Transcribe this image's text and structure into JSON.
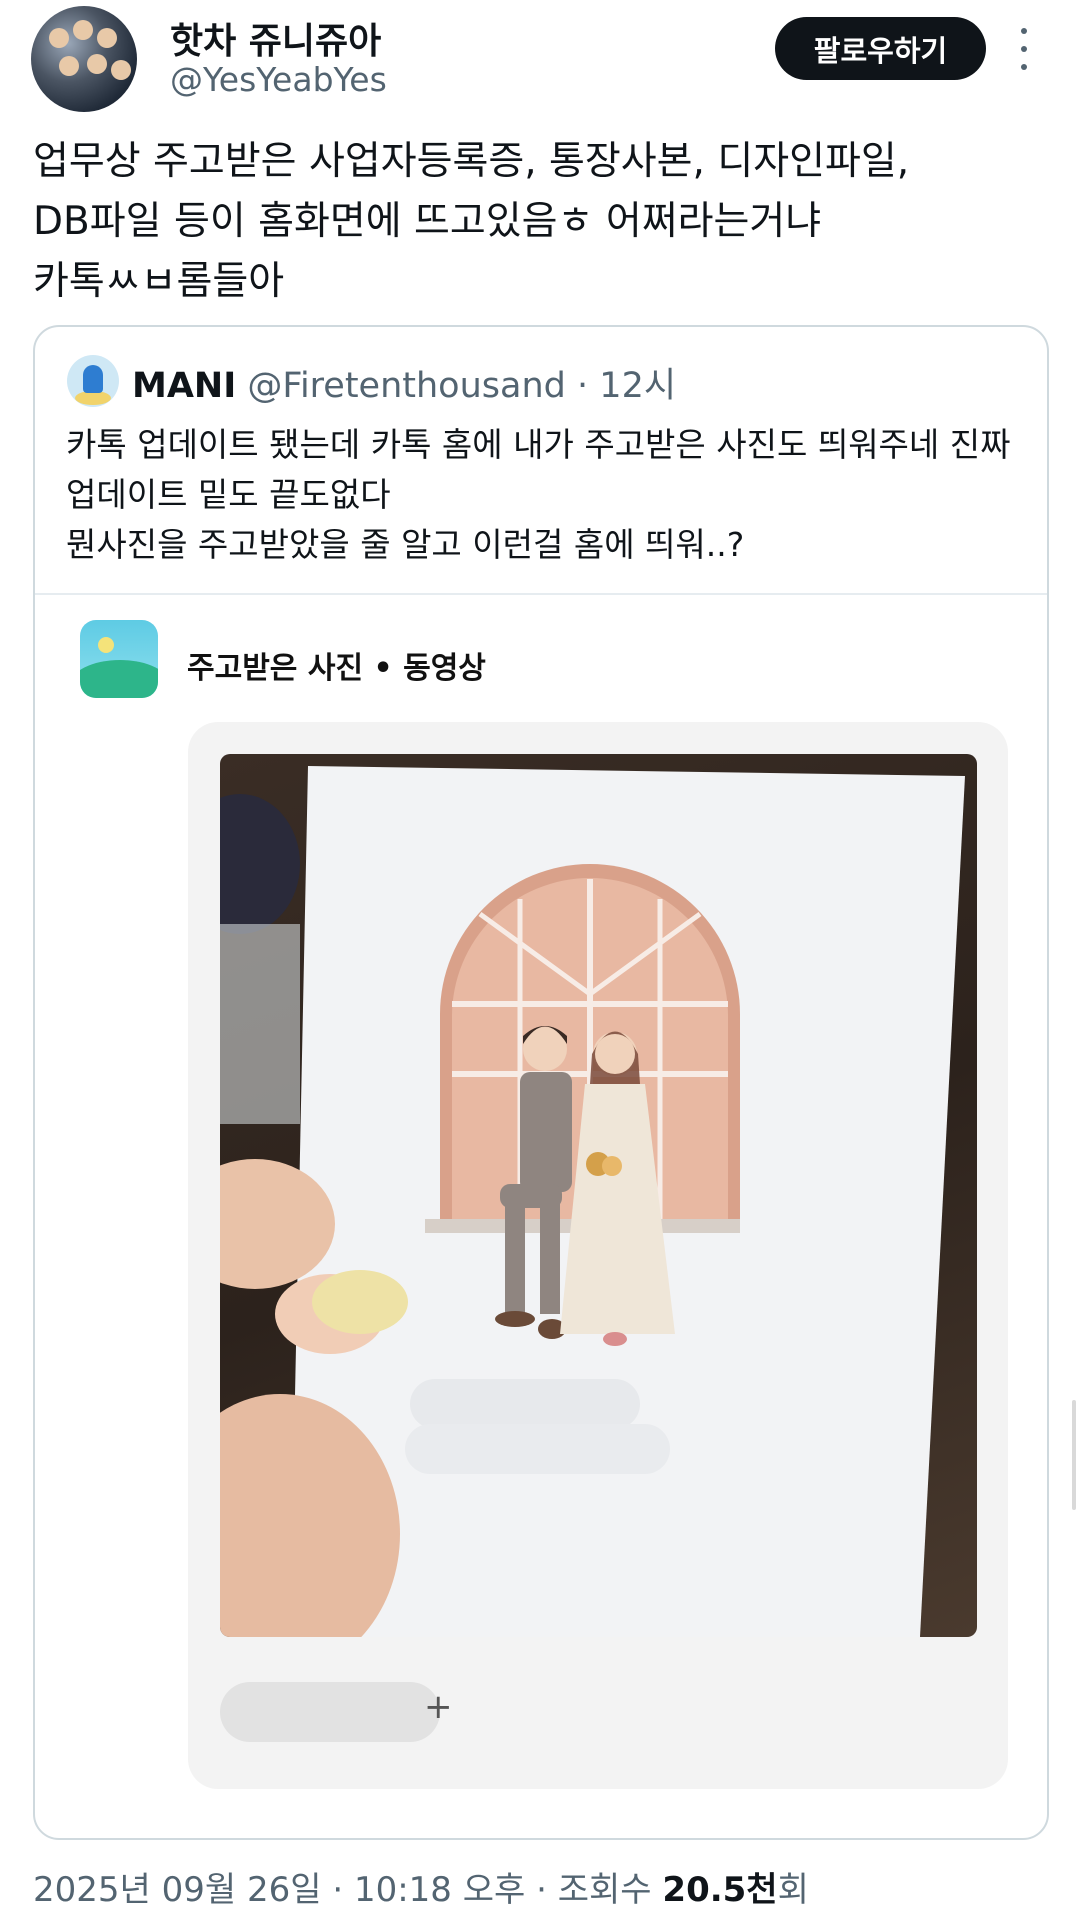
{
  "author": {
    "display_name": "핫차 쥬니쥬아",
    "handle": "@YesYeabYes",
    "follow_label": "팔로우하기",
    "more_icon": "more-vertical-icon"
  },
  "tweet": {
    "text": "업무상 주고받은 사업자등록증, 통장사본, 디자인파일,\nDB파일 등이 홈화면에 뜨고있음ㅎ 어쩌라는거냐\n카톡ㅆㅂ롬들아"
  },
  "quote": {
    "name": "MANI",
    "handle": "@Firetenthousand",
    "separator": "·",
    "time": "12시",
    "text": "카톡 업데이트 됐는데 카톡 홈에 내가 주고받은 사진도 띄워주네 진짜\n업데이트 밑도 끝도없다\n뭔사진을 주고받았을 줄 알고 이런걸 홈에 띄워..?",
    "media": {
      "section_title": "주고받은 사진 • 동영상",
      "plus": "+"
    }
  },
  "footer": {
    "date": "2025년 09월 26일",
    "sep1": " · ",
    "time": "10:18 오후",
    "sep2": " · ",
    "views_label": "조회수 ",
    "views_count": "20.5천",
    "views_suffix": "회"
  },
  "colors": {
    "text_primary": "#0f1419",
    "text_secondary": "#536471",
    "border": "#cfd9de",
    "follow_bg": "#0f1419"
  }
}
